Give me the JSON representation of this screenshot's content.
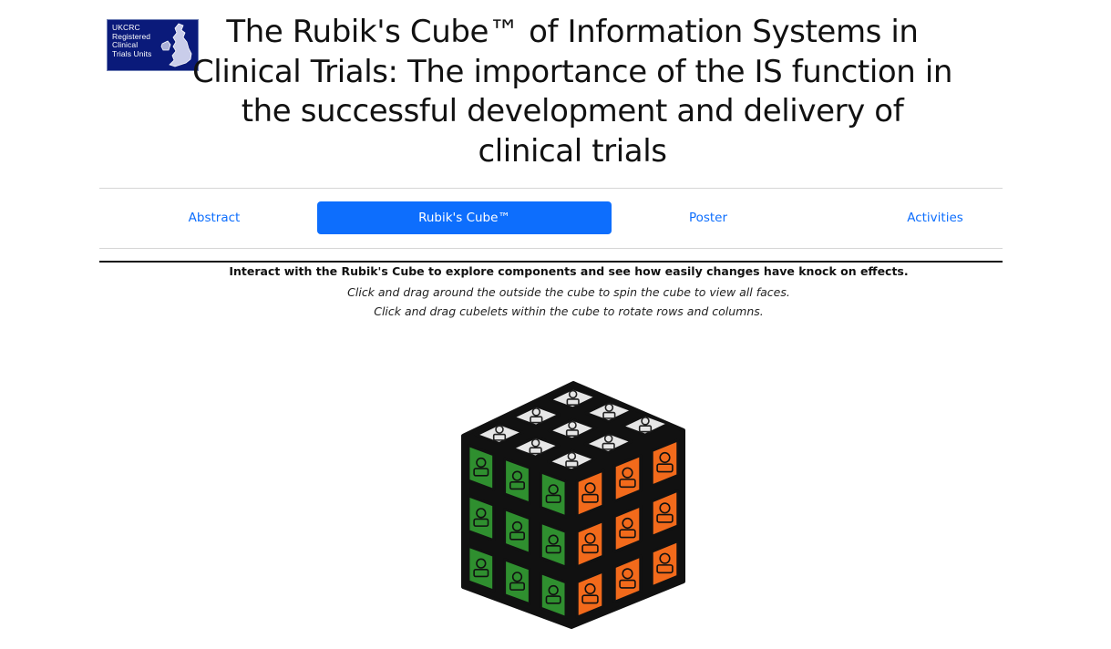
{
  "logo": {
    "text": "UKCRC\nRegistered\nClinical\nTrials  Units"
  },
  "title": "The Rubik's Cube™ of Information Systems in Clinical Trials: The importance of the IS function in the successful development and delivery of clinical trials",
  "tabs": [
    {
      "label": "Abstract",
      "active": false
    },
    {
      "label": "Rubik's Cube™",
      "active": true
    },
    {
      "label": "Poster",
      "active": false
    },
    {
      "label": "Activities",
      "active": false
    }
  ],
  "instructions": {
    "heading": "Interact with the Rubik's Cube to explore components and see how easily changes have knock on effects.",
    "line1": "Click and drag around the outside the cube to spin the cube to view all faces.",
    "line2": "Click and drag cubelets within the cube to rotate rows and columns."
  },
  "colors": {
    "accent": "#0d6efd",
    "logo_bg": "#0a1a7a",
    "face_top": "#e6e6e6",
    "face_left": "#2f8f2f",
    "face_right": "#f26a1b"
  },
  "cube": {
    "icons_top": [
      "laptop-icon",
      "monitor-icon",
      "code-window-icon",
      "lock-icon",
      "bug-icon",
      "shield-icon",
      "key-icon",
      "browser-icon",
      "server-icon",
      "network-icon",
      "gear-icon",
      "checklist-icon",
      "chart-icon",
      "handshake-icon",
      "form-icon",
      "help-icon"
    ],
    "icons_left": [
      "checkmark-icon",
      "pie-chart-icon",
      "database-icon",
      "window-icon",
      "bar-chart-icon",
      "folder-icon",
      "gear-icon",
      "camera-icon",
      "document-icon",
      "user-icon",
      "stack-icon",
      "person-icon"
    ],
    "icons_right": [
      "group-icon",
      "person-icon",
      "team-icon",
      "user-group-icon",
      "doctor-icon",
      "wifi-icon",
      "hospital-icon",
      "user-icon",
      "person-icon",
      "heart-icon",
      "person-icon",
      "badge-icon"
    ]
  }
}
